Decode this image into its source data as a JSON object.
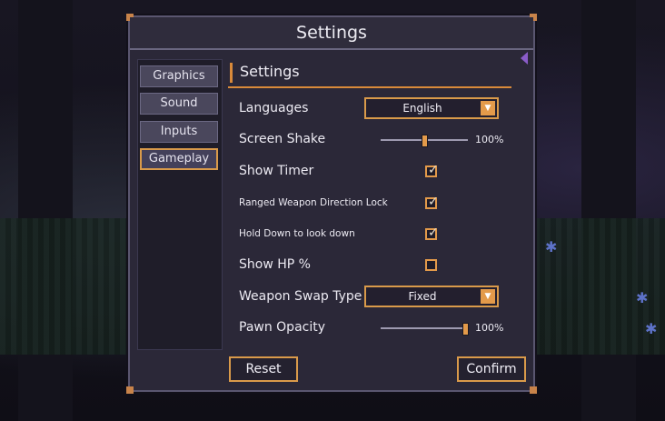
{
  "dialog": {
    "title": "Settings"
  },
  "tabs": [
    {
      "label": "Graphics",
      "active": false
    },
    {
      "label": "Sound",
      "active": false
    },
    {
      "label": "Inputs",
      "active": false
    },
    {
      "label": "Gameplay",
      "active": true
    }
  ],
  "section": {
    "heading": "Settings"
  },
  "settings": {
    "languages": {
      "label": "Languages",
      "value": "English"
    },
    "screen_shake": {
      "label": "Screen Shake",
      "percent_text": "100%",
      "level": 0.5
    },
    "show_timer": {
      "label": "Show Timer",
      "checked": true
    },
    "ranged_lock": {
      "label": "Ranged Weapon Direction Lock",
      "checked": true
    },
    "hold_down": {
      "label": "Hold Down to look down",
      "checked": true
    },
    "show_hp": {
      "label": "Show HP %",
      "checked": false
    },
    "weapon_swap": {
      "label": "Weapon Swap Type",
      "value": "Fixed"
    },
    "pawn_opacity": {
      "label": "Pawn Opacity",
      "percent_text": "100%",
      "level": 1.0
    }
  },
  "footer": {
    "reset_label": "Reset",
    "confirm_label": "Confirm"
  },
  "colors": {
    "accent": "#d99a4a",
    "panel": "#2b2838",
    "tab": "#4a475c"
  }
}
